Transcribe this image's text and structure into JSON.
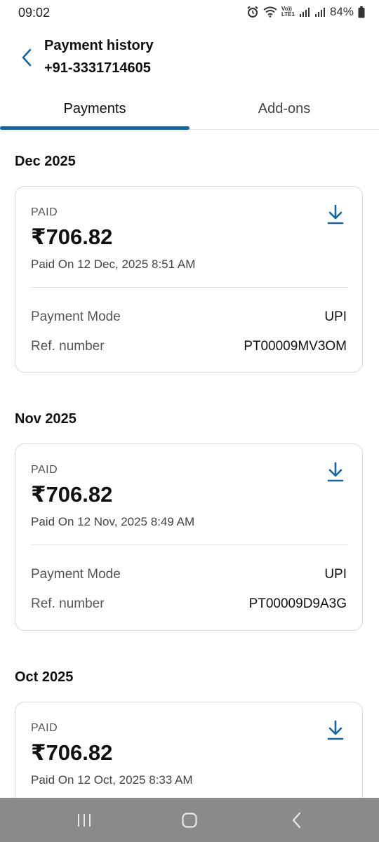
{
  "status_bar": {
    "time": "09:02",
    "battery": "84%",
    "volte_label": "Vo))",
    "lte_label": "LTE1"
  },
  "header": {
    "title": "Payment history",
    "subtitle": "+91-3331714605"
  },
  "tabs": [
    {
      "label": "Payments",
      "active": true
    },
    {
      "label": "Add-ons",
      "active": false
    }
  ],
  "colors": {
    "accent": "#1565a0",
    "nav_bar": "#8a8a8a"
  },
  "payments": [
    {
      "month": "Dec 2025",
      "status": "PAID",
      "amount": "₹706.82",
      "paid_on": "Paid On 12 Dec, 2025 8:51 AM",
      "mode_label": "Payment Mode",
      "mode_value": "UPI",
      "ref_label": "Ref. number",
      "ref_value": "PT00009MV3OM"
    },
    {
      "month": "Nov 2025",
      "status": "PAID",
      "amount": "₹706.82",
      "paid_on": "Paid On 12 Nov, 2025 8:49 AM",
      "mode_label": "Payment Mode",
      "mode_value": "UPI",
      "ref_label": "Ref. number",
      "ref_value": "PT00009D9A3G"
    },
    {
      "month": "Oct 2025",
      "status": "PAID",
      "amount": "₹706.82",
      "paid_on": "Paid On 12 Oct, 2025 8:33 AM"
    }
  ],
  "icons": {
    "back": "chevron-left-icon",
    "download": "download-icon",
    "nav_recents": "recents-icon",
    "nav_home": "home-icon",
    "nav_back": "back-icon"
  }
}
